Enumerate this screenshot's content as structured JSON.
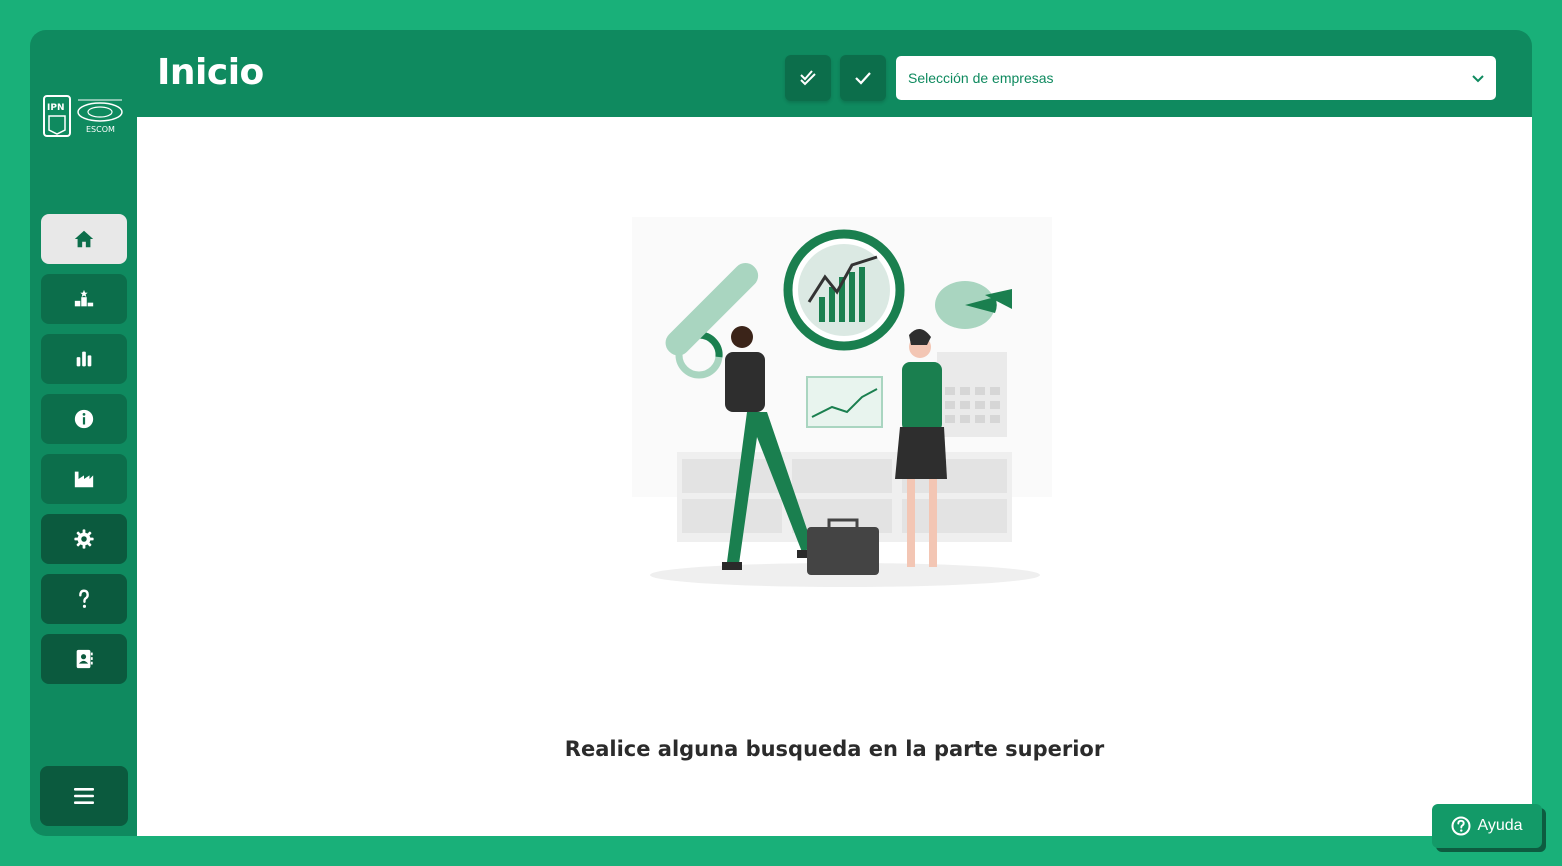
{
  "header": {
    "title": "Inicio",
    "company_select_placeholder": "Selección de empresas"
  },
  "sidebar": {
    "logo_text": "ESCOM",
    "logo_mark": "IPN",
    "items": [
      {
        "icon": "home-icon",
        "active": true
      },
      {
        "icon": "ranking-podium-icon"
      },
      {
        "icon": "bar-chart-icon"
      },
      {
        "icon": "info-icon"
      },
      {
        "icon": "factory-icon"
      },
      {
        "icon": "gear-icon"
      },
      {
        "icon": "question-icon"
      },
      {
        "icon": "contact-book-icon"
      }
    ],
    "menu_icon": "hamburger-icon"
  },
  "main": {
    "message": "Realice alguna busqueda en la parte superior"
  },
  "help": {
    "label": "Ayuda"
  },
  "colors": {
    "background": "#19b079",
    "panel": "#0f8a5f",
    "button": "#0c6e4b",
    "button_dark": "#0b5a3e",
    "accent": "#1a7f4f"
  }
}
